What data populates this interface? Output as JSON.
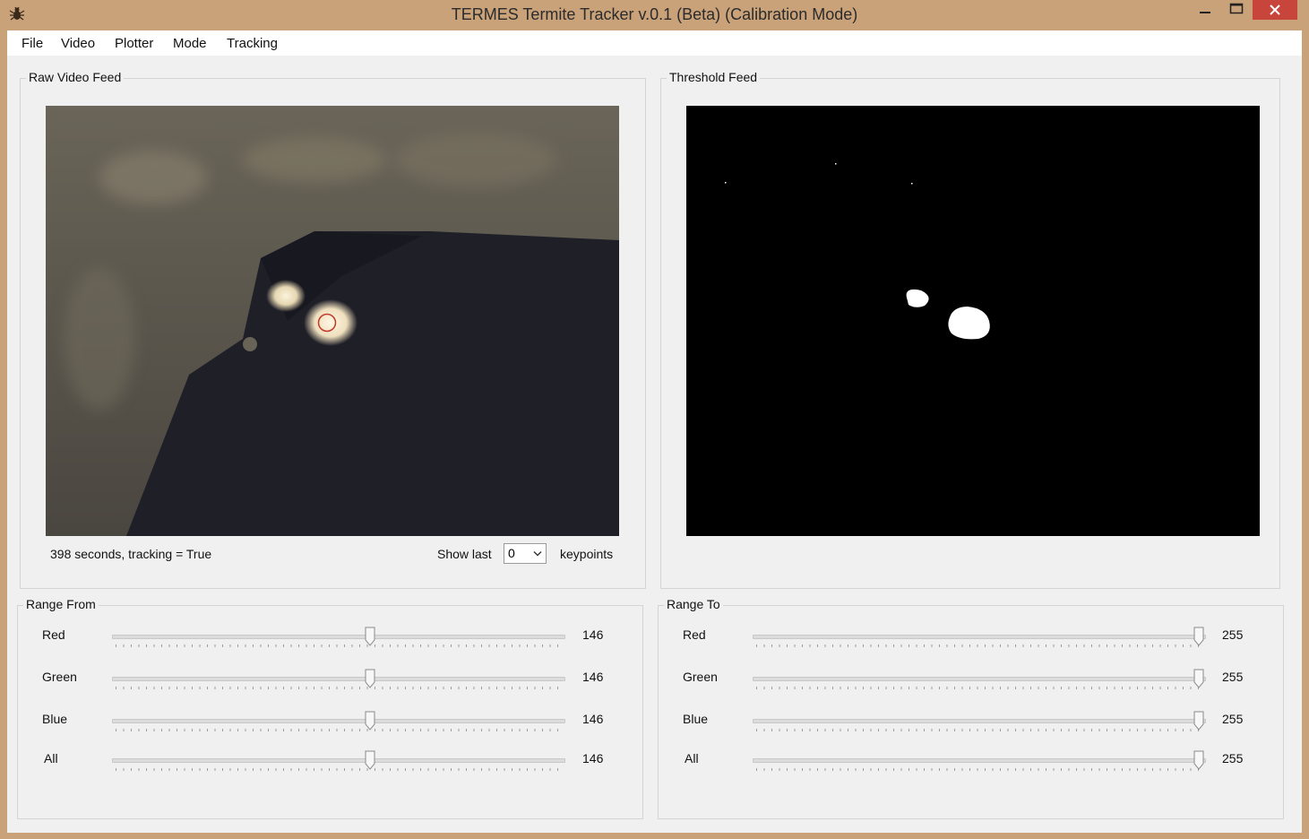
{
  "window": {
    "title": "TERMES Termite Tracker v.0.1 (Beta) (Calibration Mode)",
    "app_icon": "termite-icon"
  },
  "menu": [
    "File",
    "Video",
    "Plotter",
    "Mode",
    "Tracking"
  ],
  "raw_feed": {
    "label": "Raw Video Feed",
    "status": "398 seconds, tracking = True",
    "show_last_label": "Show last",
    "show_last_value": "0",
    "keypoints_label": "keypoints"
  },
  "threshold_feed": {
    "label": "Threshold Feed"
  },
  "range_from": {
    "label": "Range From",
    "rows": [
      {
        "label": "Red",
        "value": "146"
      },
      {
        "label": "Green",
        "value": "146"
      },
      {
        "label": "Blue",
        "value": "146"
      },
      {
        "label": "All",
        "value": "146"
      }
    ]
  },
  "range_to": {
    "label": "Range To",
    "rows": [
      {
        "label": "Red",
        "value": "255"
      },
      {
        "label": "Green",
        "value": "255"
      },
      {
        "label": "Blue",
        "value": "255"
      },
      {
        "label": "All",
        "value": "255"
      }
    ]
  },
  "slider_max": 255,
  "colors": {
    "titlebar": "#c9a27a",
    "close": "#c7453b",
    "panel": "#f0f0f0",
    "marker": "#c0392b"
  }
}
